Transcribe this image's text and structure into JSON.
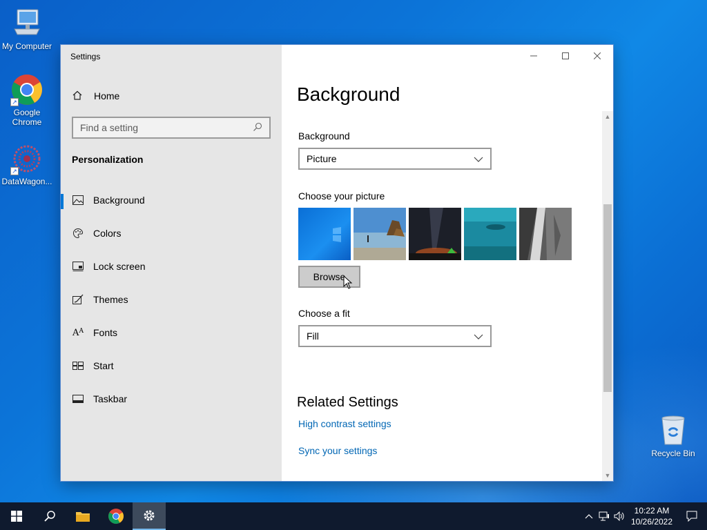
{
  "desktop": {
    "icons": [
      {
        "label": "My Computer"
      },
      {
        "label": "Google Chrome"
      },
      {
        "label": "DataWagon..."
      }
    ],
    "recycle_bin": "Recycle Bin"
  },
  "settings": {
    "window_title": "Settings",
    "nav": {
      "home": "Home",
      "search_placeholder": "Find a setting",
      "section": "Personalization",
      "items": [
        {
          "label": "Background",
          "icon": "picture-icon",
          "active": true
        },
        {
          "label": "Colors",
          "icon": "palette-icon"
        },
        {
          "label": "Lock screen",
          "icon": "lock-screen-icon"
        },
        {
          "label": "Themes",
          "icon": "themes-icon"
        },
        {
          "label": "Fonts",
          "icon": "fonts-icon"
        },
        {
          "label": "Start",
          "icon": "start-icon"
        },
        {
          "label": "Taskbar",
          "icon": "taskbar-icon"
        }
      ]
    },
    "content": {
      "title": "Background",
      "background_label": "Background",
      "background_value": "Picture",
      "choose_picture_label": "Choose your picture",
      "browse_label": "Browse",
      "choose_fit_label": "Choose a fit",
      "fit_value": "Fill",
      "related_title": "Related Settings",
      "links": [
        "High contrast settings",
        "Sync your settings"
      ]
    },
    "accent_color": "#0078d7",
    "link_color": "#0066b4"
  },
  "taskbar": {
    "time": "10:22 AM",
    "date": "10/26/2022"
  }
}
